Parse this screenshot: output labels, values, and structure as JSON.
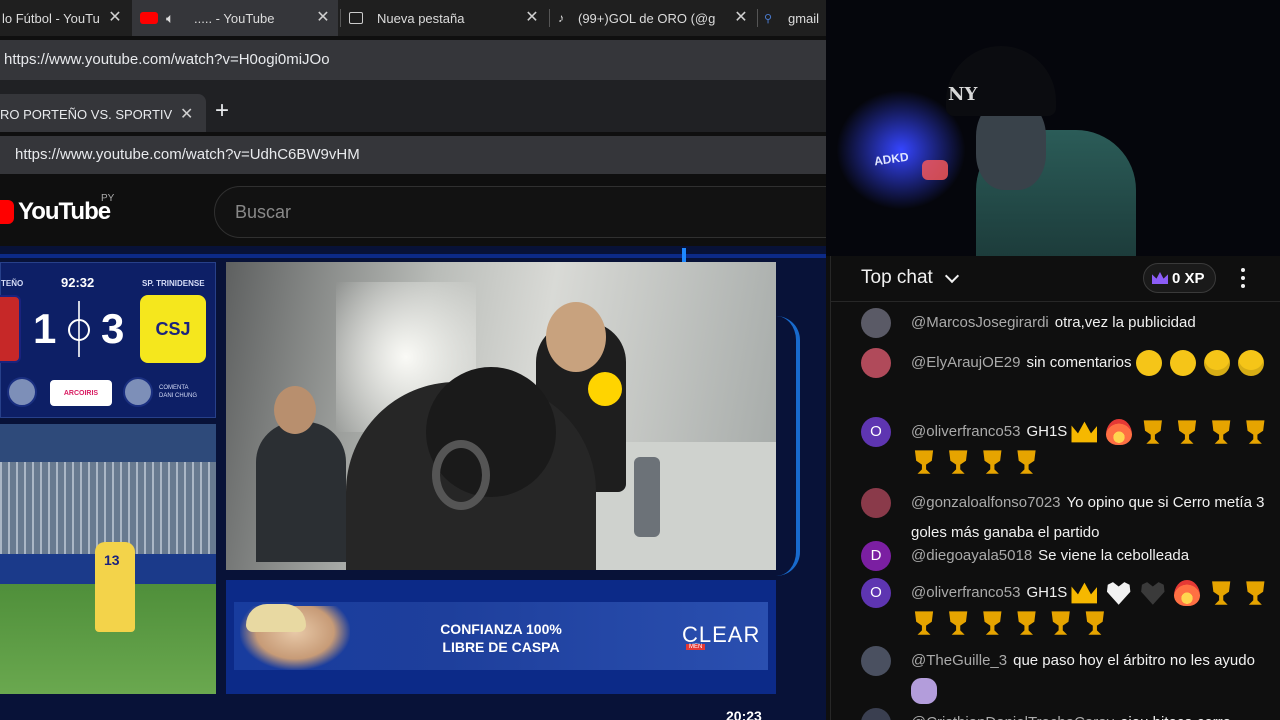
{
  "browser1": {
    "tabs": [
      {
        "title": "lo Fútbol - YouTu",
        "favicon": "generic-page-icon"
      },
      {
        "title": "..... - YouTube",
        "favicon": "youtube-icon"
      },
      {
        "title": "Nueva pestaña",
        "favicon": "new-tab-icon"
      },
      {
        "title": "(99+)GOL de ORO (@g",
        "favicon": "tiktok-icon"
      },
      {
        "title": "gmail",
        "favicon": "search-icon"
      }
    ],
    "url": "https://www.youtube.com/watch?v=H0ogi0miJOo"
  },
  "browser2": {
    "tab_title": "RO PORTEÑO VS. SPORTIVO T",
    "url": "https://www.youtube.com/watch?v=UdhC6BW9vHM"
  },
  "youtube": {
    "logo_text": "YouTube",
    "region": "PY",
    "search_placeholder": "Buscar"
  },
  "scoreboard": {
    "home_label": "TEÑO",
    "away_label": "SP. TRINIDENSE",
    "clock": "92:32",
    "home_score": "1",
    "away_score": "3",
    "away_crest": "CSJ",
    "sponsor": "ARCOIRIS",
    "commentator_label": "COMENTA",
    "commentator_name": "DANI CHUNG",
    "keeper_number": "13",
    "home_color": "#c62828",
    "away_color": "#f5e71d"
  },
  "ad": {
    "headline_1": "CONFIANZA 100%",
    "headline_2": "LIBRE DE CASPA",
    "brand": "CLEAR",
    "brand_sub": "MEN"
  },
  "video": {
    "timecode": "20:23"
  },
  "webcam": {
    "cap_logo": "NY",
    "sign_text": "ADKD"
  },
  "chat": {
    "title": "Top chat",
    "xp": "0 XP",
    "messages": [
      {
        "author": "@MarcosJosegirardi",
        "text": "otra,vez la publicidad",
        "avatar_letter": "",
        "avatar_color": "#5a5a66",
        "emojis": []
      },
      {
        "author": "@ElyAraujOE29",
        "text": "sin comentarios",
        "avatar_letter": "",
        "avatar_color": "#b04a5a",
        "emojis": [
          "sneezing-face-emoji",
          "tired-face-emoji",
          "frowning-face-emoji",
          "frowning-face-emoji"
        ]
      },
      {
        "author": "@oliverfranco53",
        "text": "GH1S",
        "avatar_letter": "O",
        "avatar_color": "#5e35b1",
        "emojis": [
          "crown-emoji",
          "fire-emoji",
          "trophy-emoji",
          "trophy-emoji",
          "trophy-emoji",
          "trophy-emoji",
          "trophy-emoji",
          "trophy-emoji",
          "trophy-emoji",
          "trophy-emoji"
        ]
      },
      {
        "author": "@gonzaloalfonso7023",
        "text": "Yo opino que si Cerro metía 3 goles más ganaba el partido",
        "avatar_letter": "",
        "avatar_color": "#8a3a4a",
        "emojis": []
      },
      {
        "author": "@diegoayala5018",
        "text": "Se viene la cebolleada",
        "avatar_letter": "D",
        "avatar_color": "#7b1fa2",
        "emojis": []
      },
      {
        "author": "@oliverfranco53",
        "text": "GH1S",
        "avatar_letter": "O",
        "avatar_color": "#5e35b1",
        "emojis": [
          "crown-emoji",
          "white-heart-emoji",
          "black-heart-emoji",
          "fire-emoji",
          "trophy-emoji",
          "trophy-emoji",
          "trophy-emoji",
          "trophy-emoji",
          "trophy-emoji",
          "trophy-emoji",
          "trophy-emoji",
          "trophy-emoji"
        ]
      },
      {
        "author": "@TheGuille_3",
        "text": "que paso hoy el árbitro no les ayudo",
        "avatar_letter": "",
        "avatar_color": "#4a5060",
        "emojis": [
          "sticker-emoji"
        ]
      },
      {
        "author": "@CristhianDanielTrochaCaray",
        "text": "ejeu biteca cerro",
        "avatar_letter": "",
        "avatar_color": "#3a3f50",
        "emojis": []
      }
    ]
  }
}
